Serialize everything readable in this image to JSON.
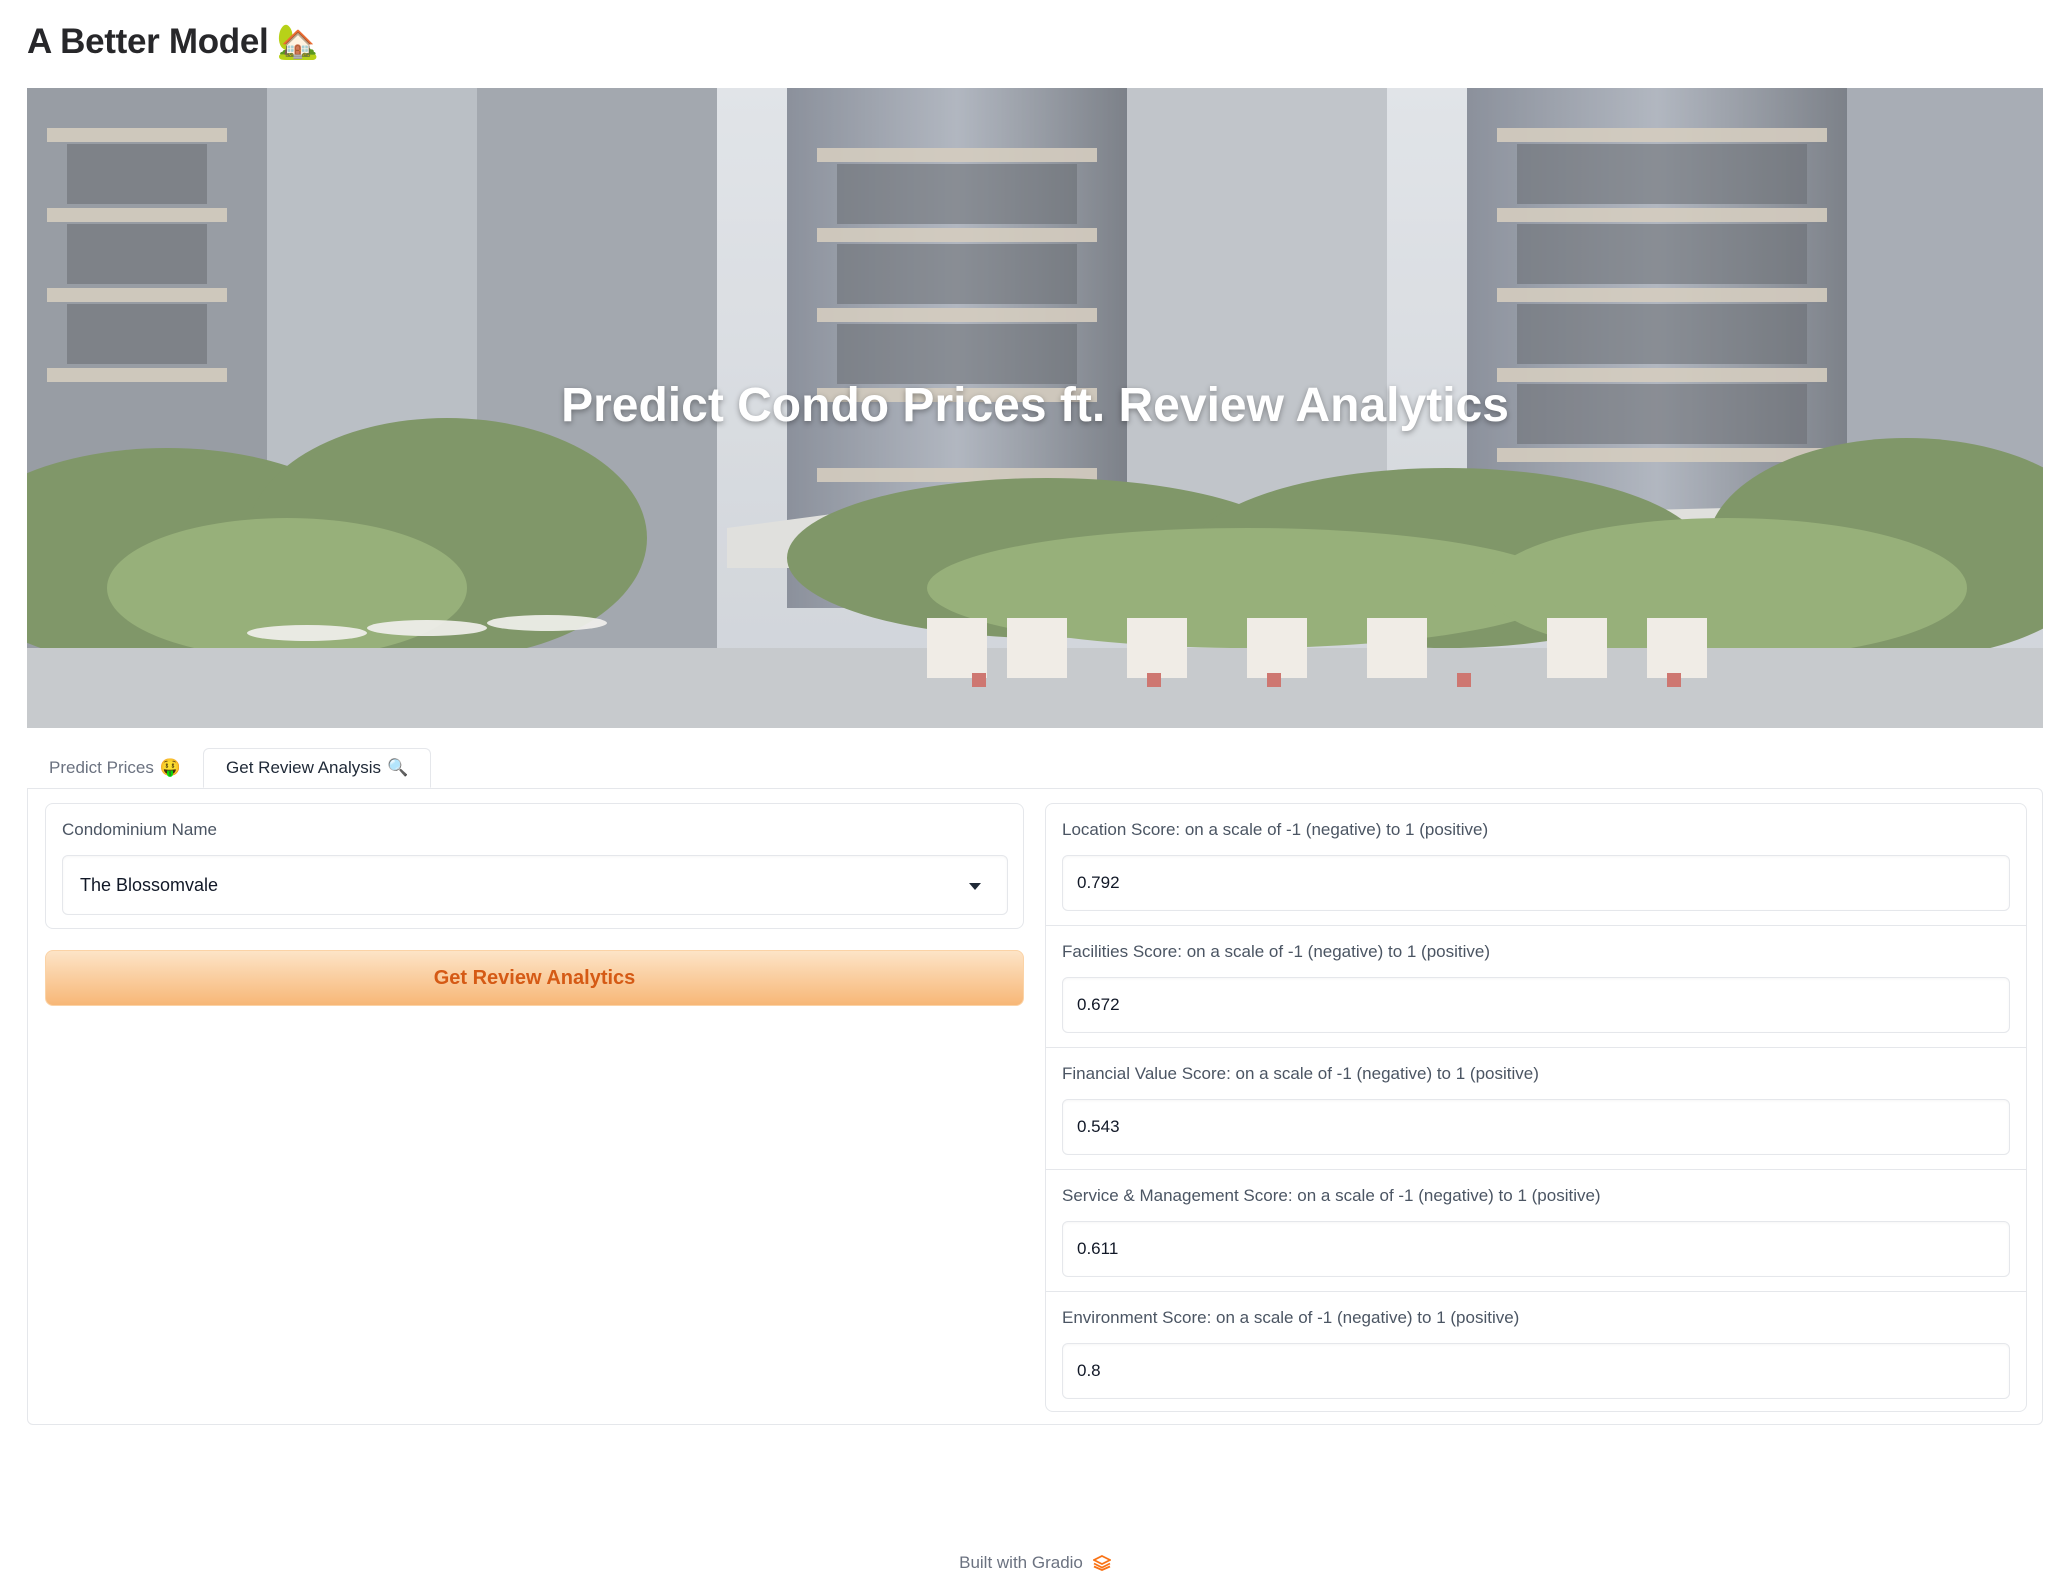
{
  "app": {
    "title": "A Better Model",
    "title_emoji": "🏡"
  },
  "hero": {
    "title": "Predict Condo Prices ft. Review Analytics"
  },
  "tabs": [
    {
      "label": "Predict Prices",
      "emoji": "🤑",
      "active": false
    },
    {
      "label": "Get Review Analysis",
      "emoji": "🔍",
      "active": true
    }
  ],
  "review": {
    "condo_label": "Condominium Name",
    "condo_value": "The Blossomvale",
    "button_label": "Get Review Analytics"
  },
  "scores": [
    {
      "label": "Location Score: on a scale of -1 (negative) to 1 (positive)",
      "value": "0.792"
    },
    {
      "label": "Facilities Score: on a scale of -1 (negative) to 1 (positive)",
      "value": "0.672"
    },
    {
      "label": "Financial Value Score: on a scale of -1 (negative) to 1 (positive)",
      "value": "0.543"
    },
    {
      "label": "Service & Management Score: on a scale of -1 (negative) to 1 (positive)",
      "value": "0.611"
    },
    {
      "label": "Environment Score: on a scale of -1 (negative) to 1 (positive)",
      "value": "0.8"
    }
  ],
  "footer": {
    "text": "Built with Gradio",
    "logo_icon": "gradio-logo-icon"
  },
  "colors": {
    "button_text": "#d55a15",
    "button_gradient_top": "#fde4c7",
    "button_gradient_bottom": "#f7b777",
    "footer_logo": "#f97316"
  }
}
